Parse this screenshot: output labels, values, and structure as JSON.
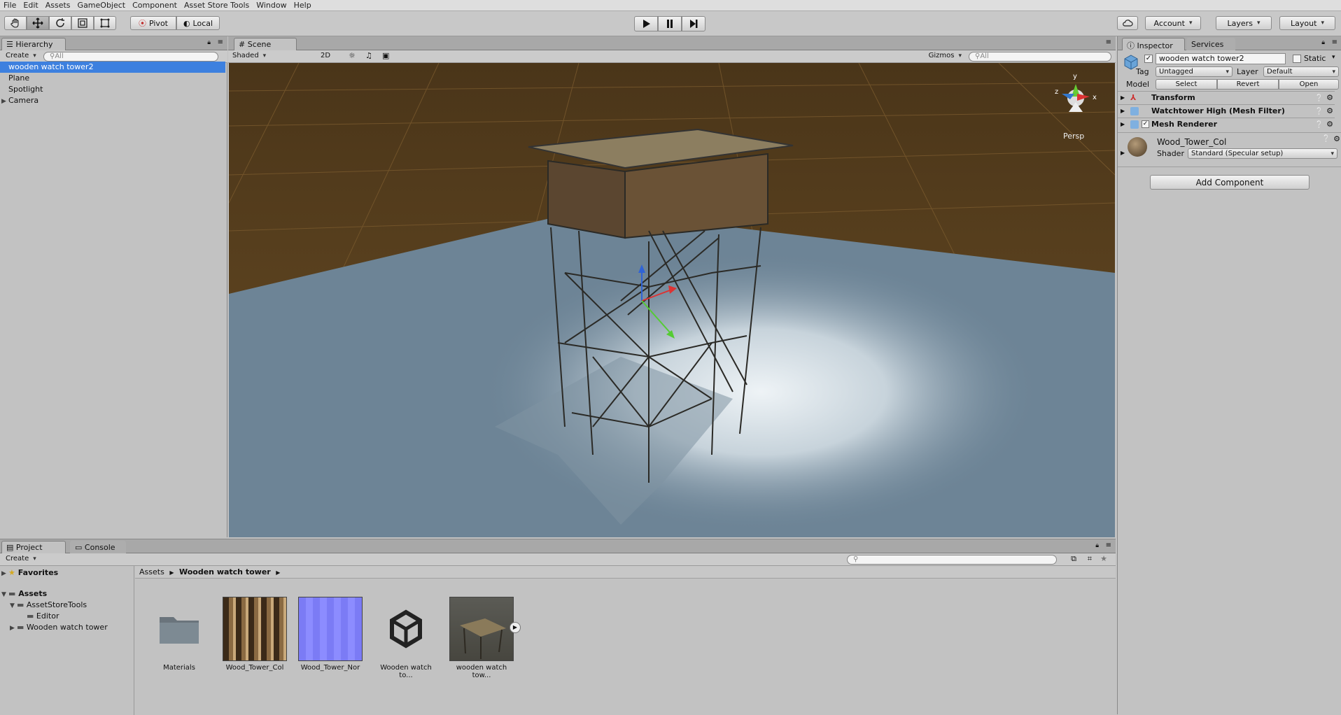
{
  "menu": [
    "File",
    "Edit",
    "Assets",
    "GameObject",
    "Component",
    "Asset Store Tools",
    "Window",
    "Help"
  ],
  "toolbar": {
    "pivot": "Pivot",
    "local": "Local",
    "account": "Account",
    "layers": "Layers",
    "layout": "Layout"
  },
  "hierarchy": {
    "tab": "Hierarchy",
    "create": "Create",
    "search_placeholder": "All",
    "items": [
      "wooden watch tower2",
      "Plane",
      "Spotlight",
      "Camera"
    ]
  },
  "scene": {
    "tab": "Scene",
    "shading": "Shaded",
    "mode_2d": "2D",
    "gizmos": "Gizmos",
    "search_placeholder": "All",
    "persp": "Persp",
    "axis_x": "x",
    "axis_y": "y",
    "axis_z": "z"
  },
  "inspector": {
    "tab": "Inspector",
    "tab2": "Services",
    "object_name": "wooden watch tower2",
    "static": "Static",
    "tag_label": "Tag",
    "tag_value": "Untagged",
    "layer_label": "Layer",
    "layer_value": "Default",
    "model_label": "Model",
    "model_buttons": [
      "Select",
      "Revert",
      "Open"
    ],
    "components": [
      "Transform",
      "Watchtower High (Mesh Filter)",
      "Mesh Renderer"
    ],
    "material_name": "Wood_Tower_Col",
    "shader_label": "Shader",
    "shader_value": "Standard (Specular setup)",
    "add_component": "Add Component"
  },
  "project": {
    "tab": "Project",
    "tab2": "Console",
    "create": "Create",
    "breadcrumb_root": "Assets",
    "breadcrumb_current": "Wooden watch tower",
    "tree": {
      "favorites": "Favorites",
      "assets": "Assets",
      "asset_store_tools": "AssetStoreTools",
      "editor": "Editor",
      "wooden_watch_tower": "Wooden watch tower"
    },
    "assets": [
      "Materials",
      "Wood_Tower_Col",
      "Wood_Tower_Nor",
      "Wooden watch to...",
      "wooden watch tow..."
    ]
  },
  "colors": {
    "selection": "#3d80df",
    "floor": "#5a4322",
    "plane": "#6d8496",
    "overlay_green": "#2fd02f"
  }
}
